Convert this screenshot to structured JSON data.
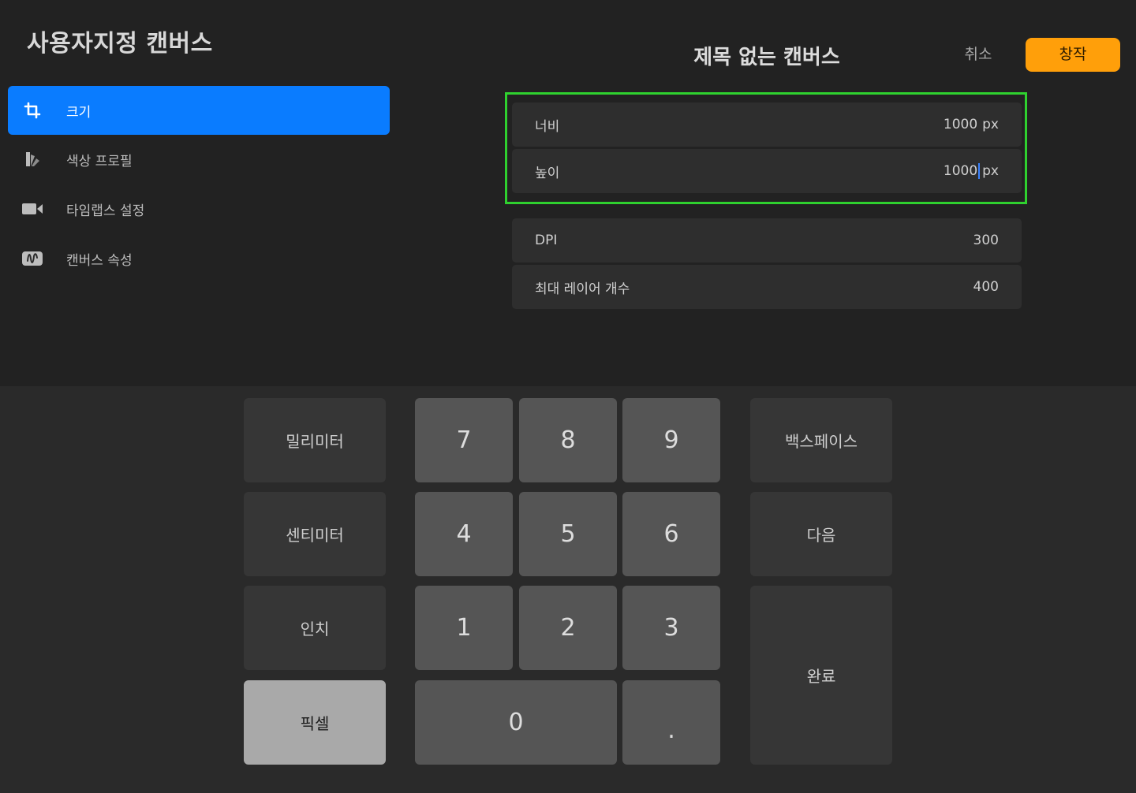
{
  "sidebar": {
    "title": "사용자지정 캔버스",
    "items": [
      {
        "label": "크기",
        "icon": "crop-icon",
        "active": true
      },
      {
        "label": "색상 프로필",
        "icon": "color-profile-icon",
        "active": false
      },
      {
        "label": "타임랩스 설정",
        "icon": "video-camera-icon",
        "active": false
      },
      {
        "label": "캔버스 속성",
        "icon": "canvas-properties-icon",
        "active": false
      }
    ]
  },
  "header": {
    "title": "제목 없는 캔버스",
    "cancel_label": "취소",
    "create_label": "창작"
  },
  "fields": {
    "width": {
      "label": "너비",
      "value": "1000",
      "unit": "px"
    },
    "height": {
      "label": "높이",
      "value": "1000",
      "unit": "px"
    },
    "dpi": {
      "label": "DPI",
      "value": "300"
    },
    "max_layers": {
      "label": "최대 레이어 개수",
      "value": "400"
    }
  },
  "keypad": {
    "units": [
      "밀리미터",
      "센티미터",
      "인치",
      "픽셀"
    ],
    "selected_unit": "픽셀",
    "digits": [
      "7",
      "8",
      "9",
      "4",
      "5",
      "6",
      "1",
      "2",
      "3",
      "0",
      "."
    ],
    "backspace_label": "백스페이스",
    "next_label": "다음",
    "done_label": "완료"
  },
  "colors": {
    "accent_blue": "#0a7cff",
    "create_orange": "#ff9f0a",
    "highlight_green": "#2fd12f"
  }
}
